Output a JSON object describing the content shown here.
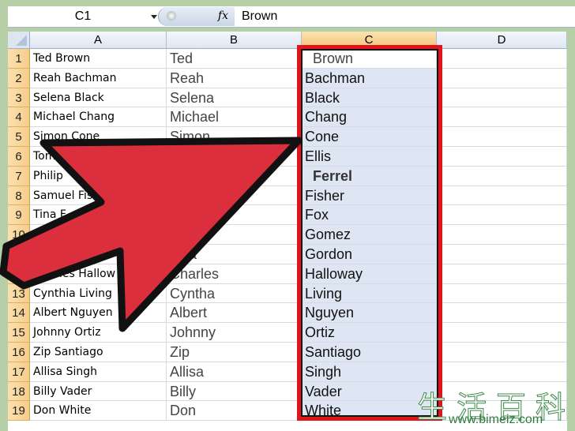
{
  "formula_bar": {
    "name_box": "C1",
    "fx_label": "fx",
    "formula": "Brown"
  },
  "columns": [
    "A",
    "B",
    "C",
    "D"
  ],
  "selected_column": "C",
  "rows": [
    {
      "n": "1",
      "a": "Ted Brown",
      "b": "Ted",
      "c": "Brown"
    },
    {
      "n": "2",
      "a": "Reah Bachman",
      "b": "Reah",
      "c": "Bachman"
    },
    {
      "n": "3",
      "a": "Selena Black",
      "b": "Selena",
      "c": "Black"
    },
    {
      "n": "4",
      "a": "Michael Chang",
      "b": "Michael",
      "c": "Chang"
    },
    {
      "n": "5",
      "a": "Simon Cone",
      "b": "Simon",
      "c": "Cone"
    },
    {
      "n": "6",
      "a": "Tom",
      "b": "",
      "c": "Ellis"
    },
    {
      "n": "7",
      "a": "Philip",
      "b": "",
      "c": "Ferrel"
    },
    {
      "n": "8",
      "a": "Samuel Fis",
      "b": "",
      "c": "Fisher"
    },
    {
      "n": "9",
      "a": "Tina F",
      "b": "",
      "c": "Fox"
    },
    {
      "n": "10",
      "a": "",
      "b": "",
      "c": "Gomez"
    },
    {
      "n": "11",
      "a": "",
      "b": "iana",
      "c": "Gordon"
    },
    {
      "n": "12",
      "a": "Charles Hallow",
      "b": "Charles",
      "c": "Halloway"
    },
    {
      "n": "13",
      "a": "Cynthia Living",
      "b": "Cyntha",
      "c": "Living"
    },
    {
      "n": "14",
      "a": "Albert Nguyen",
      "b": "Albert",
      "c": "Nguyen"
    },
    {
      "n": "15",
      "a": "Johnny Ortiz",
      "b": "Johnny",
      "c": "Ortiz"
    },
    {
      "n": "16",
      "a": "Zip Santiago",
      "b": "Zip",
      "c": "Santiago"
    },
    {
      "n": "17",
      "a": "Allisa Singh",
      "b": "Allisa",
      "c": "Singh"
    },
    {
      "n": "18",
      "a": "Billy Vader",
      "b": "Billy",
      "c": "Vader"
    },
    {
      "n": "19",
      "a": "Don White",
      "b": "Don",
      "c": "White"
    }
  ],
  "highlight": {
    "border_color": "#e0141b",
    "arrow_color": "#dc2f3e",
    "selection_color": "#dee6f3"
  },
  "watermark": {
    "chars": "生活百科",
    "url": "www.bimeiz.com"
  }
}
